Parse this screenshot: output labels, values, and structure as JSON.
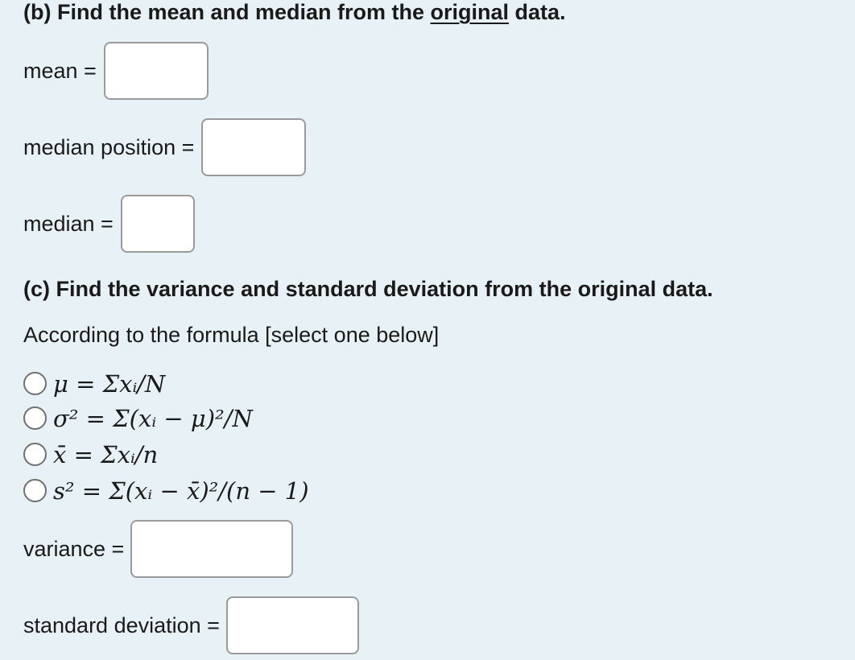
{
  "part_b": {
    "heading_prefix": "(b) Find the mean and median from the ",
    "heading_emphasis": "original",
    "heading_suffix": " data.",
    "mean_label": "mean =",
    "mean_value": "",
    "median_position_label": "median position =",
    "median_position_value": "",
    "median_label": "median =",
    "median_value": ""
  },
  "part_c": {
    "heading": "(c) Find the variance and standard deviation from the original data.",
    "instruction": "According to the formula [select one below]",
    "formula_options": [
      "μ = Σxᵢ/N",
      "σ² = Σ(xᵢ − μ)²/N",
      "x̄ = Σxᵢ/n",
      "s² = Σ(xᵢ − x̄)²/(n − 1)"
    ],
    "variance_label": "variance =",
    "variance_value": "",
    "std_dev_label": "standard deviation =",
    "std_dev_value": ""
  },
  "colors": {
    "background": "#e8f2f6",
    "input_border": "#9a9a9a",
    "radio_border": "#707070"
  }
}
